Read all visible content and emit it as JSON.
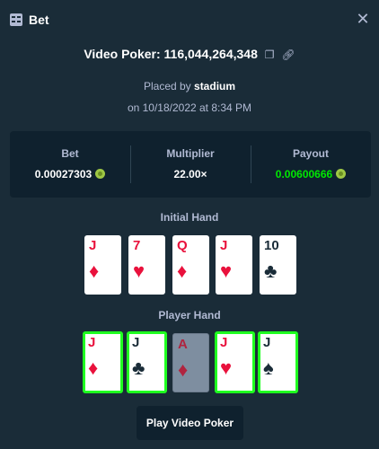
{
  "header": {
    "title": "Bet",
    "close_icon": "close-icon",
    "bet_icon": "bet-slip-icon"
  },
  "game": {
    "title": "Video Poker: 116,044,264,348",
    "copy_icon": "copy-icon",
    "link_icon": "link-icon",
    "placed_prefix": "Placed by",
    "placed_user": "stadium",
    "date": "on 10/18/2022 at 8:34 PM"
  },
  "stats": {
    "bet_label": "Bet",
    "bet_value": "0.00027303",
    "multiplier_label": "Multiplier",
    "multiplier_value": "22.00×",
    "payout_label": "Payout",
    "payout_value": "0.00600666",
    "currency_icon": "coin-icon",
    "payout_color": "#00e701"
  },
  "initial_hand": {
    "label": "Initial Hand",
    "cards": [
      {
        "rank": "J",
        "suit": "♦",
        "color": "red"
      },
      {
        "rank": "7",
        "suit": "♥",
        "color": "red"
      },
      {
        "rank": "Q",
        "suit": "♦",
        "color": "red"
      },
      {
        "rank": "J",
        "suit": "♥",
        "color": "red"
      },
      {
        "rank": "10",
        "suit": "♣",
        "color": "black"
      }
    ]
  },
  "player_hand": {
    "label": "Player Hand",
    "cards": [
      {
        "rank": "J",
        "suit": "♦",
        "color": "red",
        "held": true
      },
      {
        "rank": "J",
        "suit": "♣",
        "color": "black",
        "held": true
      },
      {
        "rank": "A",
        "suit": "♦",
        "color": "red",
        "held": false
      },
      {
        "rank": "J",
        "suit": "♥",
        "color": "red",
        "held": true
      },
      {
        "rank": "J",
        "suit": "♠",
        "color": "black",
        "held": true
      }
    ]
  },
  "play_button": "Play Video Poker",
  "colors": {
    "background": "#1a2c38",
    "panel": "#0f212e",
    "accent_green": "#1fff20",
    "card_red": "#e9113c"
  }
}
